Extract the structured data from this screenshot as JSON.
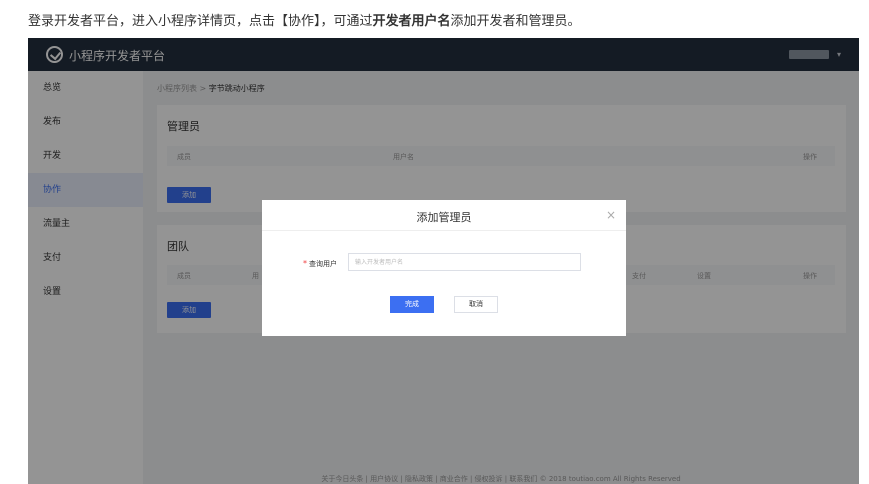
{
  "intro": {
    "part1": "登录开发者平台，进入小程序详情页，点击【协作】，可通过",
    "bold": "开发者用户名",
    "part2": "添加开发者和管理员。"
  },
  "topbar": {
    "brand": "小程序开发者平台",
    "caret": "▾"
  },
  "sidebar": {
    "items": [
      {
        "label": "总览"
      },
      {
        "label": "发布"
      },
      {
        "label": "开发"
      },
      {
        "label": "协作"
      },
      {
        "label": "流量主"
      },
      {
        "label": "支付"
      },
      {
        "label": "设置"
      }
    ]
  },
  "breadcrumb": {
    "parent": "小程序列表",
    "separator": ">",
    "current": "字节跳动小程序"
  },
  "admins": {
    "title": "管理员",
    "columns": {
      "member": "成员",
      "username": "用户名",
      "ops": "操作"
    },
    "add": "添加"
  },
  "team": {
    "title": "团队",
    "columns": {
      "member": "成员",
      "user": "用",
      "pay": "支付",
      "settings": "设置",
      "ops": "操作"
    },
    "add": "添加"
  },
  "footer": "关于今日头条 | 用户协议 | 隐私政策 | 商业合作 | 侵权投诉 | 联系我们 © 2018 toutiao.com All Rights Reserved",
  "modal": {
    "title": "添加管理员",
    "close": "×",
    "required_mark": "*",
    "field_label": "查询用户",
    "field_placeholder": "输入开发者用户名",
    "field_value": "",
    "ok": "完成",
    "cancel": "取消"
  },
  "colors": {
    "topbar": "#232f3e",
    "accent": "#3c6ff2",
    "required": "#f04142"
  }
}
